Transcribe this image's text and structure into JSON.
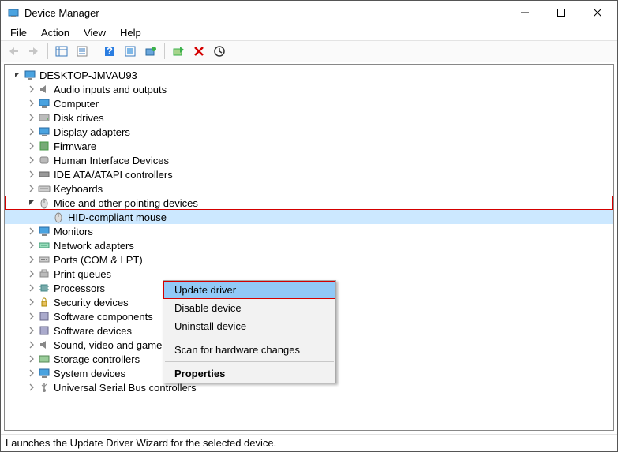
{
  "title": "Device Manager",
  "menus": {
    "file": "File",
    "action": "Action",
    "view": "View",
    "help": "Help"
  },
  "root": "DESKTOP-JMVAU93",
  "categories": [
    {
      "label": "Audio inputs and outputs",
      "icon": "audio"
    },
    {
      "label": "Computer",
      "icon": "computer"
    },
    {
      "label": "Disk drives",
      "icon": "disk"
    },
    {
      "label": "Display adapters",
      "icon": "display"
    },
    {
      "label": "Firmware",
      "icon": "firmware"
    },
    {
      "label": "Human Interface Devices",
      "icon": "hid"
    },
    {
      "label": "IDE ATA/ATAPI controllers",
      "icon": "ide"
    },
    {
      "label": "Keyboards",
      "icon": "keyboard"
    },
    {
      "label": "Mice and other pointing devices",
      "icon": "mouse",
      "expanded": true,
      "highlighted": true,
      "children": [
        {
          "label": "HID-compliant mouse",
          "icon": "mouse",
          "selected": true
        }
      ]
    },
    {
      "label": "Monitors",
      "icon": "monitor"
    },
    {
      "label": "Network adapters",
      "icon": "network"
    },
    {
      "label": "Ports (COM & LPT)",
      "icon": "port"
    },
    {
      "label": "Print queues",
      "icon": "printer"
    },
    {
      "label": "Processors",
      "icon": "cpu"
    },
    {
      "label": "Security devices",
      "icon": "security"
    },
    {
      "label": "Software components",
      "icon": "swcomp"
    },
    {
      "label": "Software devices",
      "icon": "swdev"
    },
    {
      "label": "Sound, video and game controllers",
      "icon": "sound"
    },
    {
      "label": "Storage controllers",
      "icon": "storage"
    },
    {
      "label": "System devices",
      "icon": "system"
    },
    {
      "label": "Universal Serial Bus controllers",
      "icon": "usb"
    }
  ],
  "context_menu": {
    "update": "Update driver",
    "disable": "Disable device",
    "uninstall": "Uninstall device",
    "scan": "Scan for hardware changes",
    "properties": "Properties"
  },
  "status": "Launches the Update Driver Wizard for the selected device."
}
